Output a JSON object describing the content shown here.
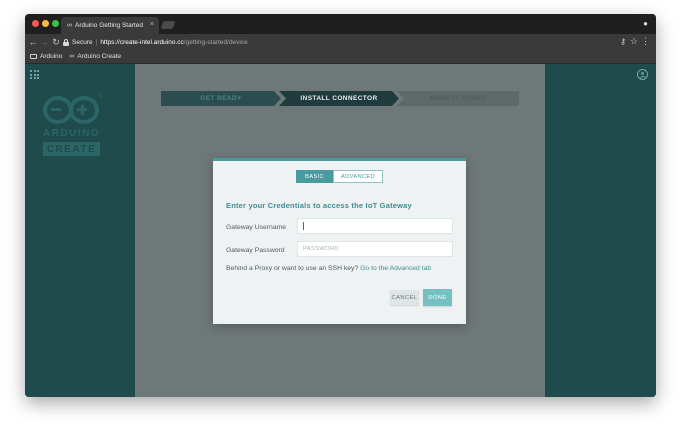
{
  "browser": {
    "tab_title": "Arduino Getting Started",
    "tab_close": "×",
    "secure_label": "Secure",
    "separator": "|",
    "url_scheme_host": "https://create-intel.arduino.cc",
    "url_path": "/getting-started/device",
    "bookmarks": [
      {
        "label": "Arduino",
        "icon": "folder-icon"
      },
      {
        "label": "Arduino Create",
        "icon": "infinity-icon"
      }
    ]
  },
  "sidebar": {
    "logo_word": "ARDUINO",
    "logo_badge": "CREATE",
    "logo_registered": "®"
  },
  "steps": [
    {
      "label": "GET READY",
      "state": "done"
    },
    {
      "label": "INSTALL CONNECTOR",
      "state": "active"
    },
    {
      "label": "MAKE IT YOURS",
      "state": "pending"
    }
  ],
  "modal": {
    "tabs": {
      "basic": "BASIC",
      "advanced": "ADVANCED",
      "selected": "basic"
    },
    "heading": "Enter your Credentials to access the IoT Gateway",
    "username_label": "Gateway Username",
    "username_value": "",
    "password_label": "Gateway Password",
    "password_placeholder": "PASSWORD",
    "proxy_text": "Behind a Proxy or want to use an SSH key? ",
    "proxy_link": "Go to the Advanced tab",
    "cancel_label": "CANCEL",
    "done_label": "DONE"
  },
  "colors": {
    "teal_dark": "#1f4b4d",
    "teal_accent": "#4a9ba0",
    "overlay": "#6f7878",
    "done_button": "#76c0c3"
  }
}
